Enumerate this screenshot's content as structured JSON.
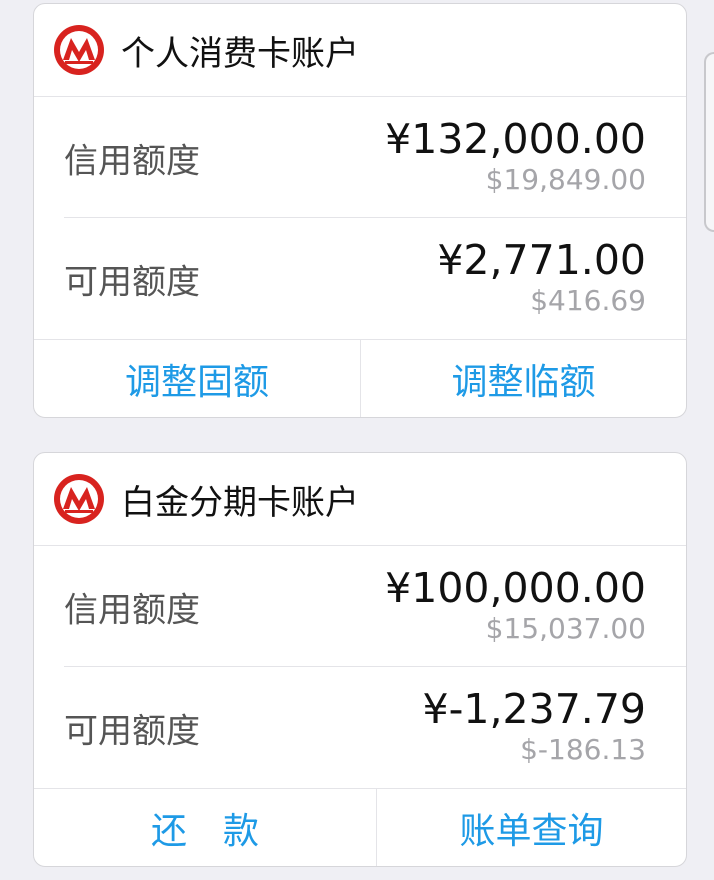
{
  "brand": {
    "primary_color": "#d8231f",
    "link_color": "#1e9ae6"
  },
  "cards": [
    {
      "title": "个人消费卡账户",
      "credit_limit": {
        "label": "信用额度",
        "cny": "¥132,000.00",
        "usd": "$19,849.00"
      },
      "available_limit": {
        "label": "可用额度",
        "cny": "¥2,771.00",
        "usd": "$416.69"
      },
      "actions": [
        "调整固额",
        "调整临额"
      ]
    },
    {
      "title": "白金分期卡账户",
      "credit_limit": {
        "label": "信用额度",
        "cny": "¥100,000.00",
        "usd": "$15,037.00"
      },
      "available_limit": {
        "label": "可用额度",
        "cny": "¥-1,237.79",
        "usd": "$-186.13"
      },
      "actions": [
        "还款",
        "账单查询"
      ]
    }
  ]
}
